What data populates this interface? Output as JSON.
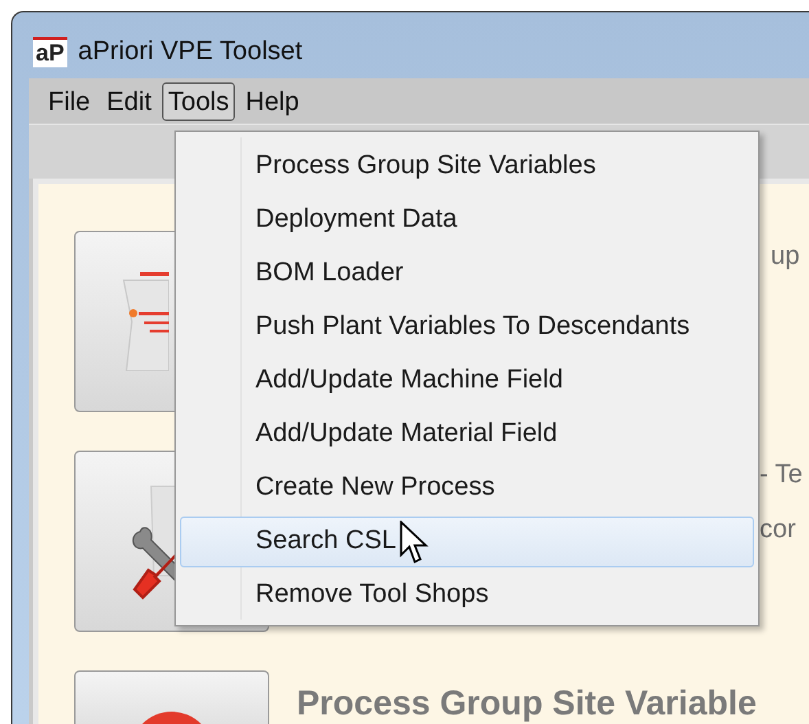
{
  "window": {
    "title": "aPriori VPE Toolset",
    "logo": "aP"
  },
  "menu_bar": [
    {
      "label": "File",
      "selected": false
    },
    {
      "label": "Edit",
      "selected": false
    },
    {
      "label": "Tools",
      "selected": true
    },
    {
      "label": "Help",
      "selected": false
    }
  ],
  "dropdown": {
    "items": [
      {
        "label": "Process Group Site Variables",
        "selected": false
      },
      {
        "label": "Deployment Data",
        "selected": false
      },
      {
        "label": "BOM Loader",
        "selected": false
      },
      {
        "label": "Push Plant Variables To Descendants",
        "selected": false
      },
      {
        "label": "Add/Update Machine Field",
        "selected": false
      },
      {
        "label": "Add/Update Material Field",
        "selected": false
      },
      {
        "label": "Create New Process",
        "selected": false
      },
      {
        "label": "Search CSL",
        "selected": true
      },
      {
        "label": "Remove Tool Shops",
        "selected": false
      }
    ]
  },
  "content": {
    "rows": [
      {
        "kind": "document",
        "lines": [
          "up"
        ]
      },
      {
        "kind": "tools",
        "lines": [
          "- Te",
          "cor"
        ]
      },
      {
        "kind": "globe",
        "title": "Process Group Site Variable"
      }
    ]
  }
}
